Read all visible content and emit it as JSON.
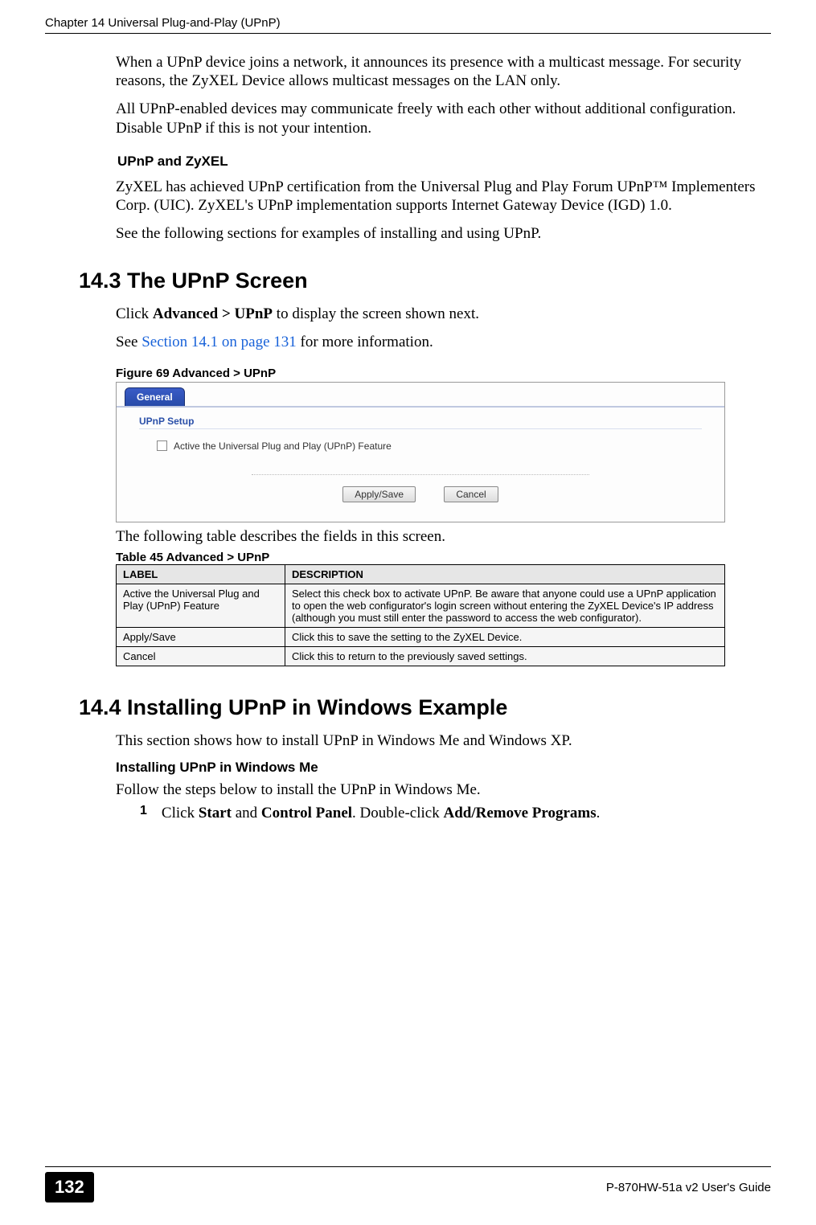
{
  "header": {
    "chapter_line": "Chapter 14 Universal Plug-and-Play (UPnP)"
  },
  "intro": {
    "p1": "When a UPnP device joins a network, it announces its presence with a multicast message. For security reasons, the ZyXEL Device allows multicast messages on the LAN only.",
    "p2": "All UPnP-enabled devices may communicate freely with each other without additional configuration. Disable UPnP if this is not your intention."
  },
  "sub1": {
    "heading": "UPnP and ZyXEL",
    "p1": "ZyXEL has achieved UPnP certification from the Universal Plug and Play Forum UPnP™ Implementers Corp. (UIC). ZyXEL's UPnP implementation supports Internet Gateway Device (IGD) 1.0.",
    "p2": "See the following sections for examples of installing and using UPnP."
  },
  "section143": {
    "heading": "14.3  The UPnP Screen",
    "p1_a": "Click ",
    "p1_b": "Advanced > UPnP",
    "p1_c": " to display the screen shown next.",
    "p2_a": "See ",
    "p2_link": "Section 14.1 on page 131",
    "p2_b": " for more information.",
    "fig_label": "Figure 69   Advanced > UPnP",
    "table_intro": "The following table describes the fields in this screen.",
    "table_caption": "Table 45   Advanced > UPnP"
  },
  "screenshot": {
    "tab": "General",
    "group": "UPnP Setup",
    "checkbox_label": "Active the Universal Plug and Play (UPnP) Feature",
    "btn_apply": "Apply/Save",
    "btn_cancel": "Cancel"
  },
  "table": {
    "head_label": "LABEL",
    "head_desc": "DESCRIPTION",
    "rows": [
      {
        "label": "Active the Universal Plug and Play (UPnP) Feature",
        "desc": "Select this check box to activate UPnP. Be aware that anyone could use a UPnP application to open the web configurator's login screen without entering the ZyXEL Device's IP address (although you must still enter the password to access the web configurator)."
      },
      {
        "label": "Apply/Save",
        "desc": "Click this to save the setting to the ZyXEL Device."
      },
      {
        "label": "Cancel",
        "desc": "Click this to return to the previously saved settings."
      }
    ]
  },
  "section144": {
    "heading": "14.4  Installing UPnP in Windows Example",
    "p1": "This section shows how to install UPnP in Windows Me and Windows XP.",
    "sub_heading": "Installing UPnP in Windows Me",
    "p2": "Follow the steps below to install the UPnP in Windows Me.",
    "step_num": "1",
    "step_a": "Click ",
    "step_b": "Start",
    "step_c": " and ",
    "step_d": "Control Panel",
    "step_e": ". Double-click ",
    "step_f": "Add/Remove Programs",
    "step_g": "."
  },
  "footer": {
    "page": "132",
    "guide": "P-870HW-51a v2 User's Guide"
  }
}
